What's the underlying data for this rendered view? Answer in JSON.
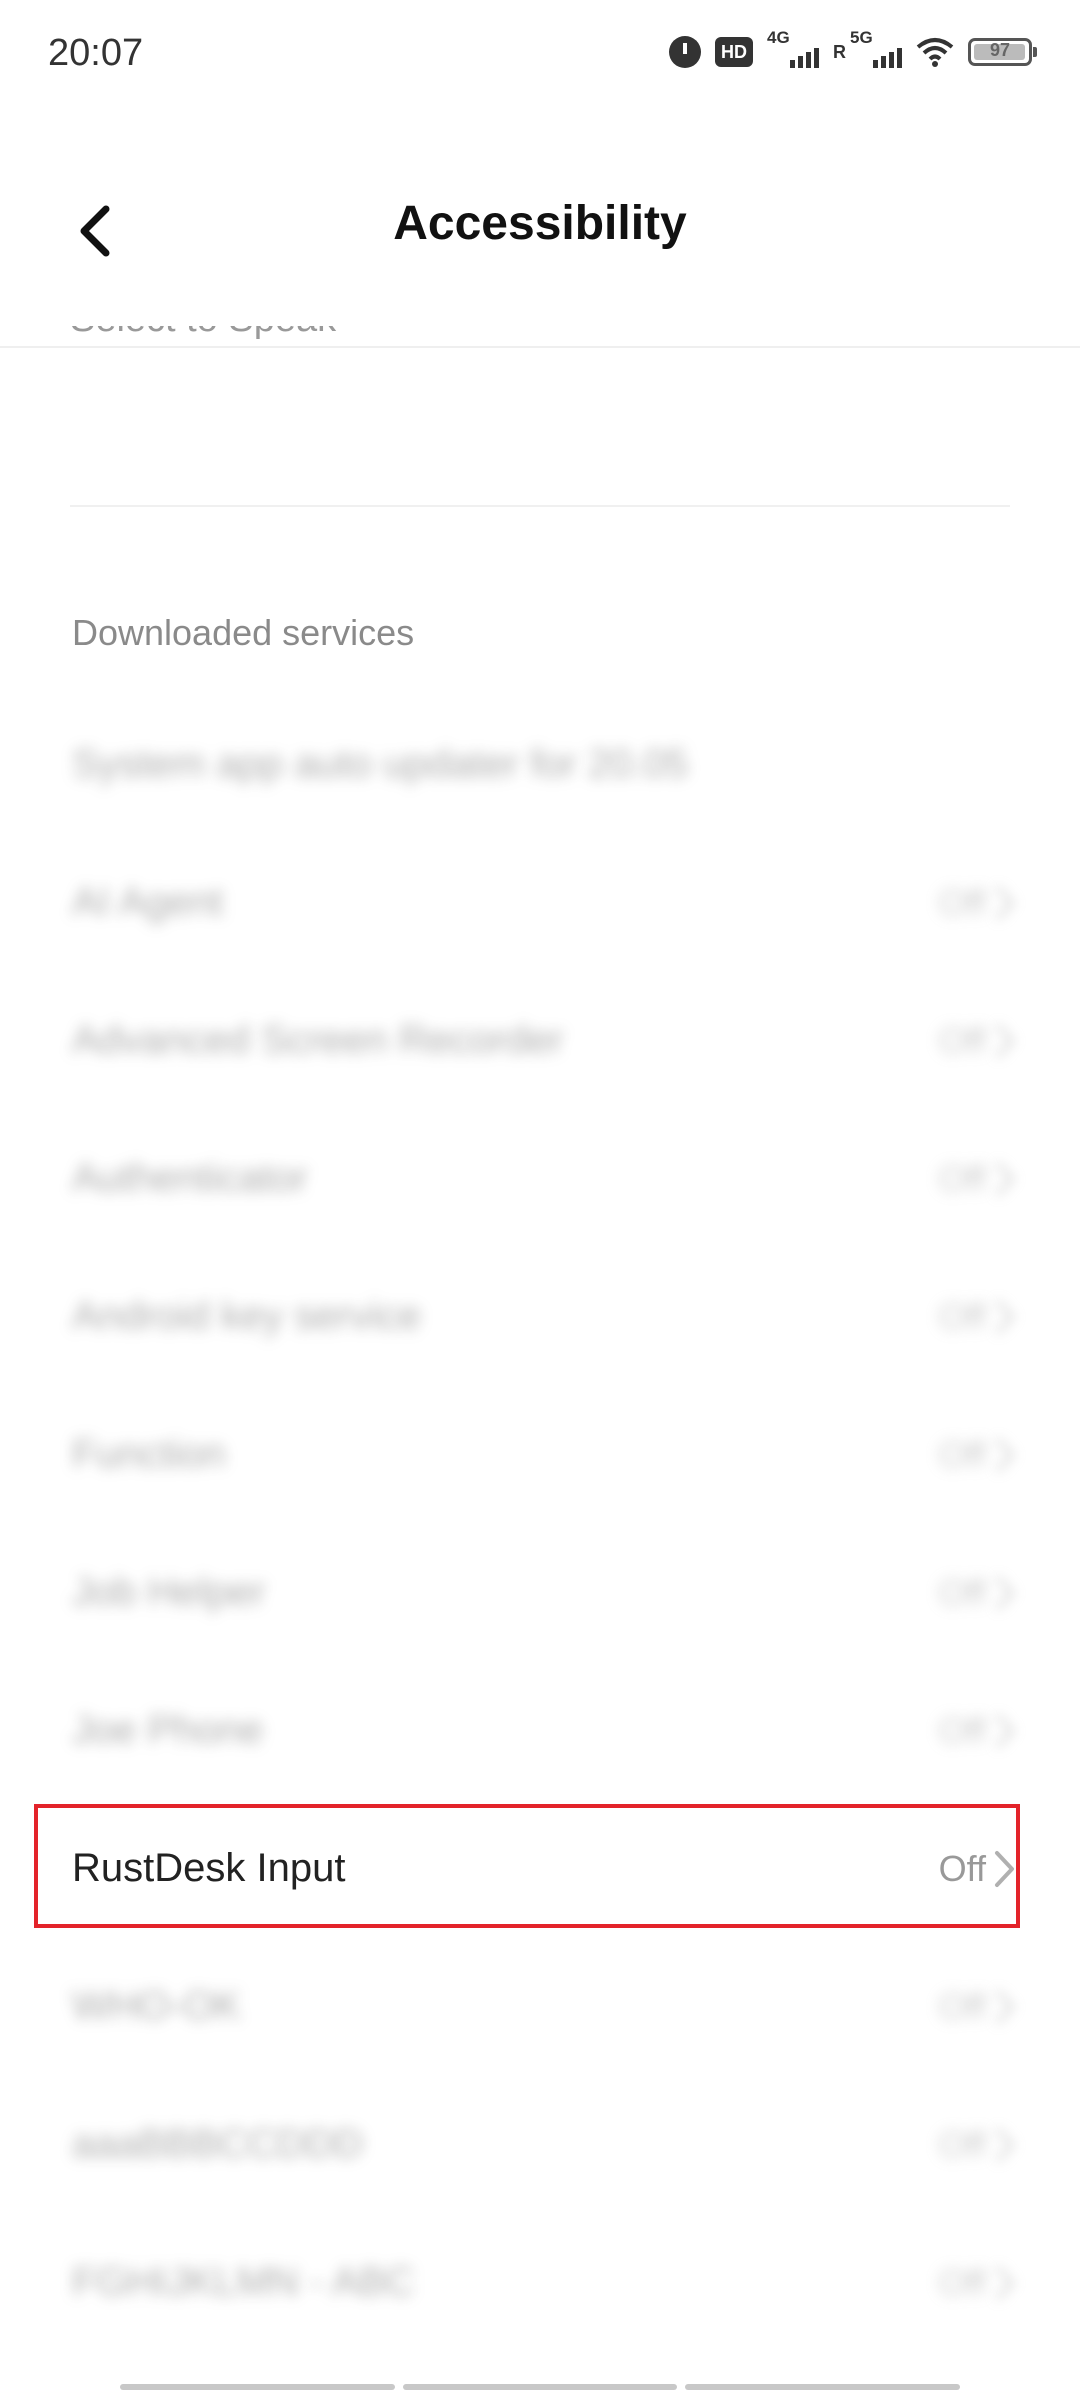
{
  "status_bar": {
    "time": "20:07",
    "hd_label": "HD",
    "net1_label": "4G",
    "net2_label": "5G",
    "roaming_label": "R",
    "battery_level": "97"
  },
  "header": {
    "title": "Accessibility",
    "back_icon": "chevron-left-icon"
  },
  "clipped_row_label": "Select to Speak",
  "section": {
    "title": "Downloaded services"
  },
  "services": [
    {
      "label": "System app auto updater for 20.05",
      "status": "",
      "blurred": true
    },
    {
      "label": "AI Agent",
      "status": "Off",
      "blurred": true
    },
    {
      "label": "Advanced Screen Recorder",
      "status": "Off",
      "blurred": true
    },
    {
      "label": "Authenticator",
      "status": "Off",
      "blurred": true
    },
    {
      "label": "Android key service",
      "status": "Off",
      "blurred": true
    },
    {
      "label": "Function",
      "status": "Off",
      "blurred": true
    },
    {
      "label": "Job Helper",
      "status": "Off",
      "blurred": true
    },
    {
      "label": "Joe Phone",
      "status": "Off",
      "blurred": true
    },
    {
      "label": "RustDesk Input",
      "status": "Off",
      "blurred": false
    },
    {
      "label": "WHO-OK",
      "status": "Off",
      "blurred": true
    },
    {
      "label": "aaaBBBCCDDD",
      "status": "Off",
      "blurred": true
    },
    {
      "label": "FGHIJKLMN - ABC",
      "status": "Off",
      "blurred": true
    }
  ],
  "highlight_color": "#e3232a"
}
